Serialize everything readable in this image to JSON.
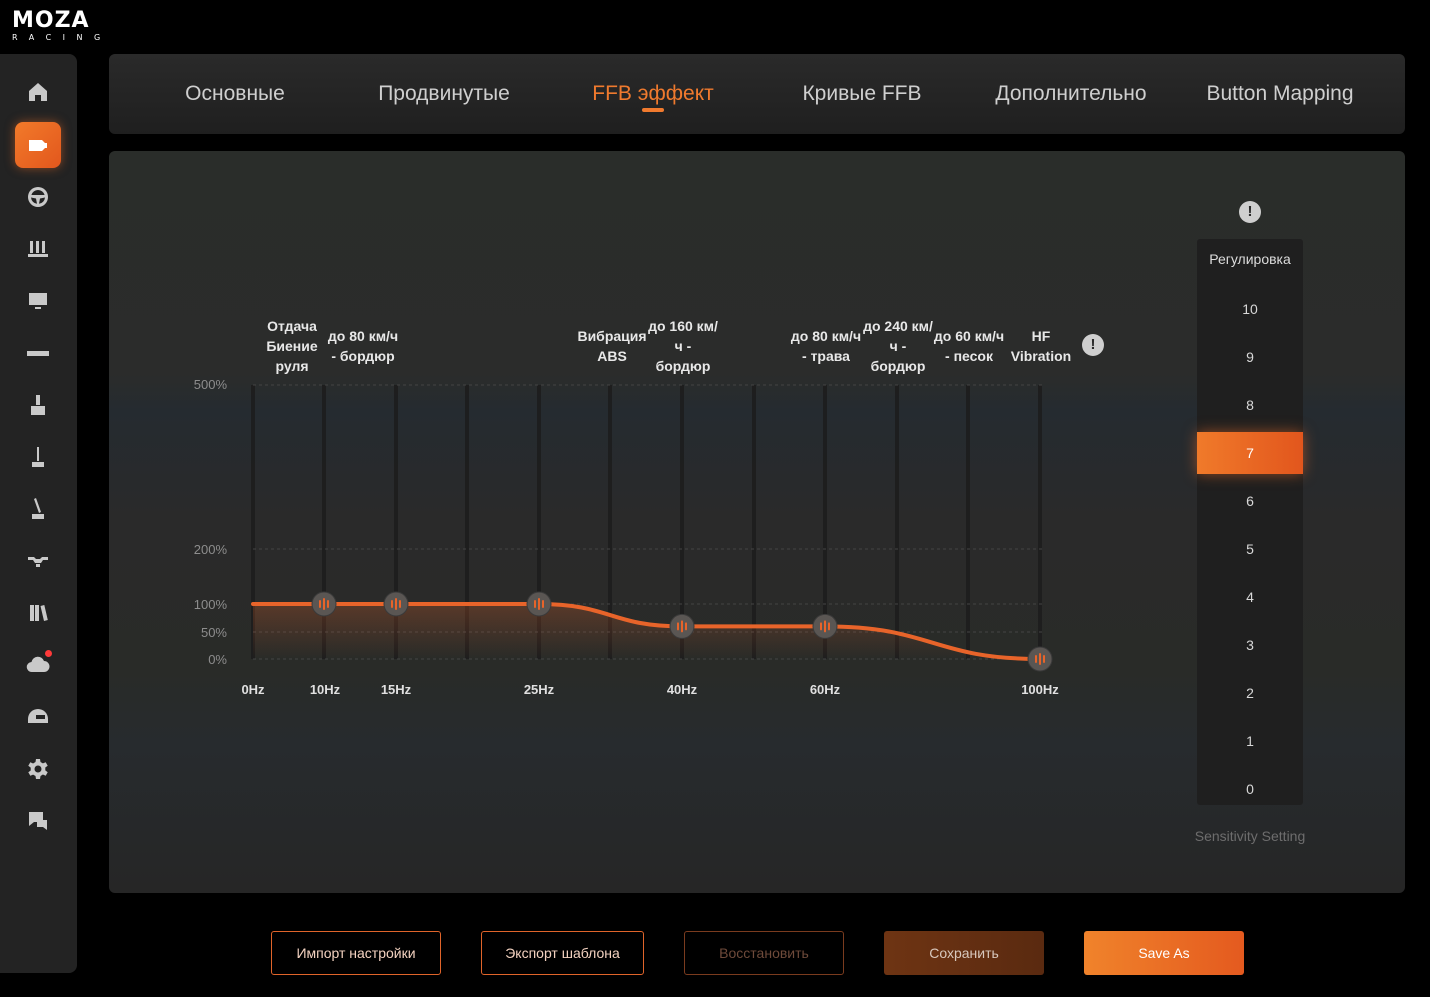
{
  "logo": {
    "main": "MOZA",
    "sub": "RACING"
  },
  "sidebar": {
    "items": [
      {
        "name": "home-icon",
        "active": false
      },
      {
        "name": "wheelbase-icon",
        "active": true
      },
      {
        "name": "steering-wheel-icon",
        "active": false
      },
      {
        "name": "pedals-icon",
        "active": false
      },
      {
        "name": "dashboard-icon",
        "active": false
      },
      {
        "name": "shifter-bar-icon",
        "active": false
      },
      {
        "name": "handbrake-icon",
        "active": false
      },
      {
        "name": "hgear-shifter-icon",
        "active": false
      },
      {
        "name": "sequential-shifter-icon",
        "active": false
      },
      {
        "name": "flight-stick-icon",
        "active": false
      },
      {
        "name": "library-icon",
        "active": false
      },
      {
        "name": "cloud-update-icon",
        "active": false,
        "notification": true
      },
      {
        "name": "helmet-icon",
        "active": false
      },
      {
        "name": "settings-gear-icon",
        "active": false
      },
      {
        "name": "qa-help-icon",
        "active": false
      }
    ]
  },
  "tabs": [
    {
      "label": "Основные",
      "active": false
    },
    {
      "label": "Продвинутые",
      "active": false
    },
    {
      "label": "FFB эффект",
      "active": true
    },
    {
      "label": "Кривые FFB",
      "active": false
    },
    {
      "label": "Дополнительно",
      "active": false
    },
    {
      "label": "Button Mapping",
      "active": false
    }
  ],
  "eq": {
    "band_labels": [
      "Отдача\nБиение\nруля",
      "до 80 км/ч\n- бордюр",
      "Вибрация\nABS",
      "до 160 км/\nч -\nбордюр",
      "до 80 км/ч\n- трава",
      "до 240 км/\nч -\nбордюр",
      "до 60 км/ч\n- песок",
      "HF\nVibration"
    ],
    "info_icon": "!",
    "y_labels": [
      "500%",
      "200%",
      "100%",
      "50%",
      "0%"
    ],
    "x_labels": [
      "0Hz",
      "10Hz",
      "15Hz",
      "25Hz",
      "40Hz",
      "60Hz",
      "100Hz"
    ],
    "points": [
      {
        "freq": "10Hz",
        "value_percent": 100
      },
      {
        "freq": "15Hz",
        "value_percent": 100
      },
      {
        "freq": "25Hz",
        "value_percent": 100
      },
      {
        "freq": "40Hz",
        "value_percent": 60
      },
      {
        "freq": "60Hz",
        "value_percent": 60
      },
      {
        "freq": "100Hz",
        "value_percent": 0
      }
    ],
    "accent_color": "#e8642a"
  },
  "sensitivity": {
    "title": "Регулировка",
    "levels": [
      "10",
      "9",
      "8",
      "7",
      "6",
      "5",
      "4",
      "3",
      "2",
      "1",
      "0"
    ],
    "selected": "7",
    "caption": "Sensitivity Setting",
    "info_icon": "!"
  },
  "buttons": {
    "import": "Импорт настройки",
    "export": "Экспорт шаблона",
    "restore": "Восстановить",
    "save": "Сохранить",
    "save_as": "Save As"
  }
}
